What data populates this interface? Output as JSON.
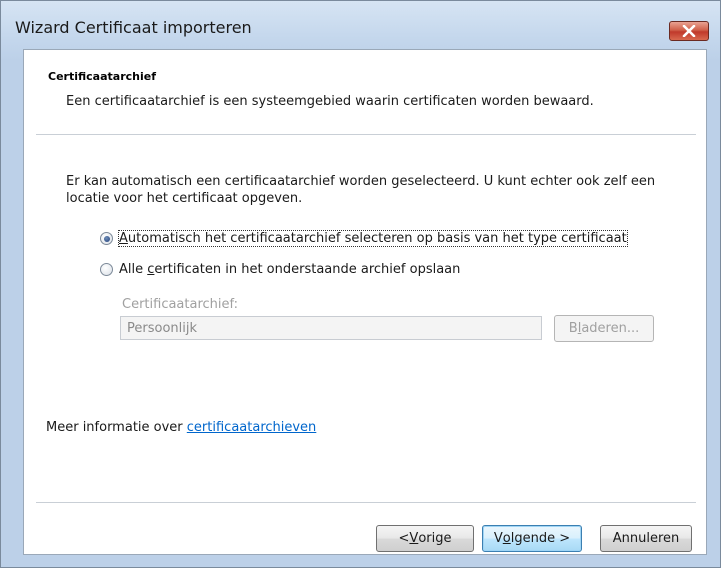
{
  "window": {
    "title": "Wizard Certificaat importeren",
    "close_icon": "close-icon"
  },
  "header": {
    "title": "Certificaatarchief",
    "description": "Een certificaatarchief is een systeemgebied waarin certificaten worden bewaard."
  },
  "body": {
    "intro": "Er kan automatisch een certificaatarchief worden geselecteerd. U kunt echter ook zelf een locatie voor het certificaat opgeven.",
    "options": [
      {
        "label_before": "",
        "accel": "A",
        "label_after": "utomatisch het certificaatarchief selecteren op basis van het type certificaat",
        "checked": true
      },
      {
        "label_before": "Alle ",
        "accel": "c",
        "label_after": "ertificaten in het onderstaande archief opslaan",
        "checked": false
      }
    ],
    "store": {
      "label": "Certificaatarchief:",
      "value": "Persoonlijk",
      "enabled": false
    },
    "browse_button": {
      "label_before": "B",
      "accel": "l",
      "label_after": "aderen...",
      "enabled": false
    },
    "more_info": {
      "prefix": "Meer informatie over ",
      "link": "certificaatarchieven"
    }
  },
  "footer": {
    "back_button": {
      "label_before": "< ",
      "accel": "V",
      "label_after": "orige"
    },
    "next_button": {
      "label_before": "V",
      "accel": "o",
      "label_after": "lgende >"
    },
    "cancel_button": {
      "label": "Annuleren"
    }
  },
  "colors": {
    "link": "#0066cc",
    "close_button": "#c0392b",
    "titlebar": "#c3d6ec",
    "default_button_border": "#3c7fb1"
  }
}
